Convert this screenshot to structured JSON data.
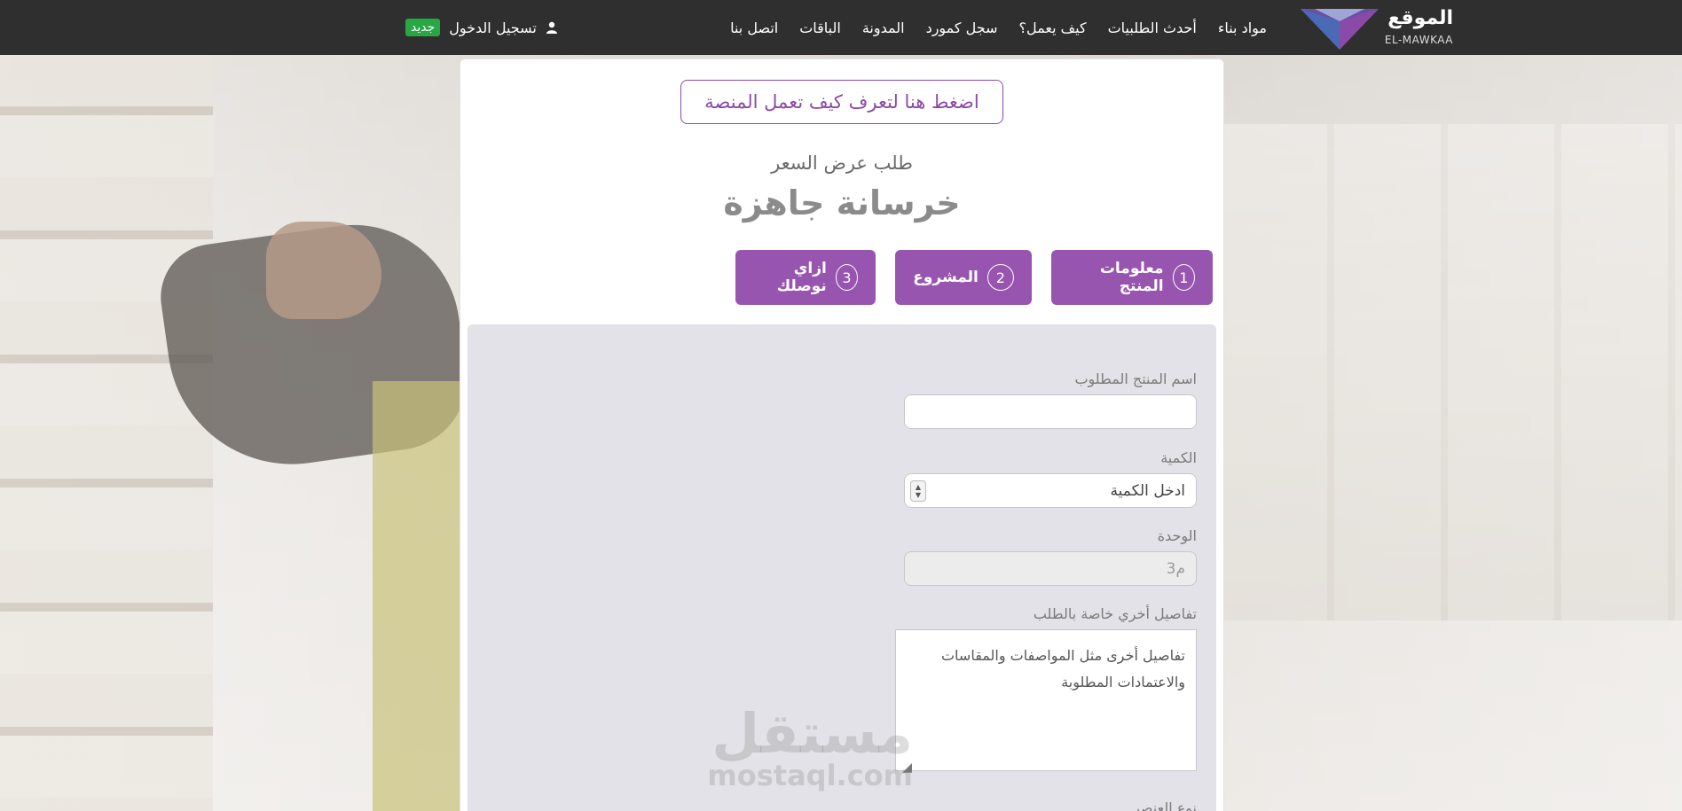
{
  "brand": {
    "name": "الموقع",
    "sub": "EL-MAWKAA"
  },
  "nav": {
    "links": [
      "مواد بناء",
      "أحدث الطلبيات",
      "كيف يعمل؟",
      "سجل كمورد",
      "المدونة",
      "الباقات",
      "اتصل بنا"
    ],
    "login": "تسجيل الدخول",
    "badge": "جديد"
  },
  "page": {
    "how_it_works": "اضغط هنا لتعرف كيف تعمل المنصة",
    "subtitle": "طلب عرض السعر",
    "title": "خرسانة جاهزة"
  },
  "steps": [
    {
      "num": "1",
      "label": "معلومات المنتج"
    },
    {
      "num": "2",
      "label": "المشروع"
    },
    {
      "num": "3",
      "label": "ازاي نوصلك"
    }
  ],
  "form": {
    "product_label": "اسم المنتج المطلوب",
    "product_value": "",
    "quantity_label": "الكمية",
    "quantity_placeholder": "ادخل الكمية",
    "unit_label": "الوحدة",
    "unit_value": "م3",
    "details_label": "تفاصيل أخري خاصة بالطلب",
    "details_placeholder": "تفاصيل أخرى مثل المواصفات والمقاسات والاعتمادات المطلوبة",
    "next_label": "نوع العنصر"
  },
  "watermark": {
    "ar": "مستقل",
    "en": "mostaql.com"
  },
  "colors": {
    "accent": "#9855b0",
    "nav_bg": "#2f2f2f",
    "badge": "#28a745"
  }
}
